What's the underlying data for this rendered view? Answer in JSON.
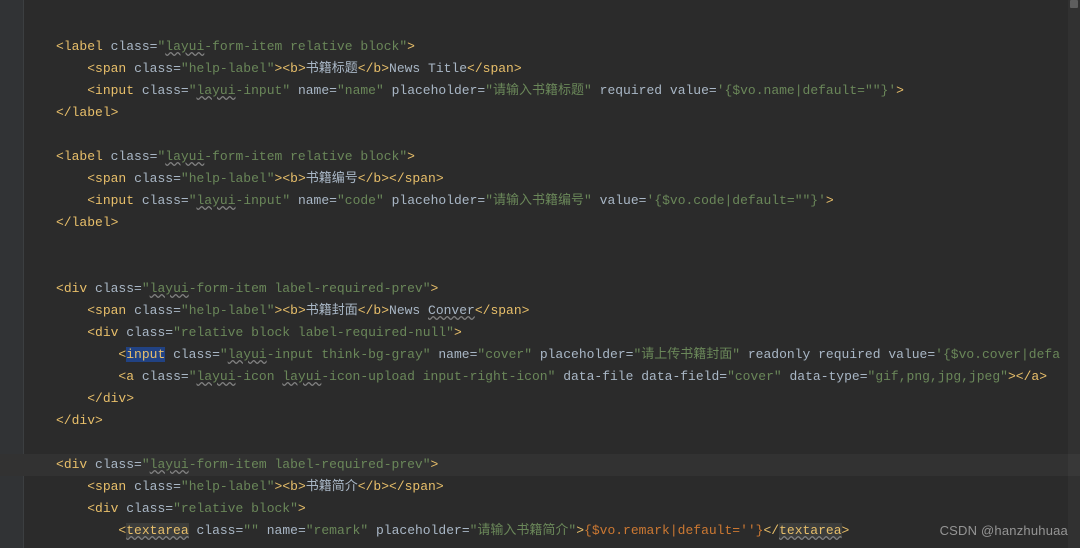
{
  "editor": {
    "highlighted_line_index": 20,
    "watermark": "CSDN @hanzhuhuaa"
  },
  "code": {
    "lines": [
      "",
      "<label class=\"layui-form-item relative block\">",
      "    <span class=\"help-label\"><b>书籍标题</b>News Title</span>",
      "    <input class=\"layui-input\" name=\"name\" placeholder=\"请输入书籍标题\" required value='{$vo.name|default=\"\"}'>",
      "</label>",
      "",
      "<label class=\"layui-form-item relative block\">",
      "    <span class=\"help-label\"><b>书籍编号</b></span>",
      "    <input class=\"layui-input\" name=\"code\" placeholder=\"请输入书籍编号\" value='{$vo.code|default=\"\"}'>",
      "</label>",
      "",
      "",
      "<div class=\"layui-form-item label-required-prev\">",
      "    <span class=\"help-label\"><b>书籍封面</b>News Conver</span>",
      "    <div class=\"relative block label-required-null\">",
      "        <input class=\"layui-input think-bg-gray\" name=\"cover\" placeholder=\"请上传书籍封面\" readonly required value='{$vo.cover|defa",
      "        <a class=\"layui-icon layui-icon-upload input-right-icon\" data-file data-field=\"cover\" data-type=\"gif,png,jpg,jpeg\"></a>",
      "    </div>",
      "</div>",
      "",
      "<div class=\"layui-form-item label-required-prev\">",
      "    <span class=\"help-label\"><b>书籍简介</b></span>",
      "    <div class=\"relative block\">",
      "        <textarea class=\"\" name=\"remark\" placeholder=\"请输入书籍简介\">{$vo.remark|default=''}</textarea>"
    ]
  },
  "tokens": {
    "tags": [
      "label",
      "span",
      "b",
      "input",
      "div",
      "a",
      "textarea"
    ],
    "attrs": [
      "class",
      "name",
      "placeholder",
      "required",
      "value",
      "readonly",
      "data-file",
      "data-field",
      "data-type"
    ],
    "strings": [
      "layui-form-item relative block",
      "help-label",
      "layui-input",
      "name",
      "请输入书籍标题",
      "'{$vo.name|default=\"\"}'",
      "code",
      "请输入书籍编号",
      "'{$vo.code|default=\"\"}'",
      "layui-form-item label-required-prev",
      "relative block label-required-null",
      "layui-input think-bg-gray",
      "cover",
      "请上传书籍封面",
      "'{$vo.cover|defa",
      "layui-icon layui-icon-upload input-right-icon",
      "gif,png,jpg,jpeg",
      "relative block",
      "remark",
      "请输入书籍简介"
    ],
    "texts": [
      "书籍标题",
      "News Title",
      "书籍编号",
      "书籍封面",
      "News ",
      "Conver",
      "书籍简介"
    ],
    "template_expr": "{$vo.remark|default=''}"
  }
}
